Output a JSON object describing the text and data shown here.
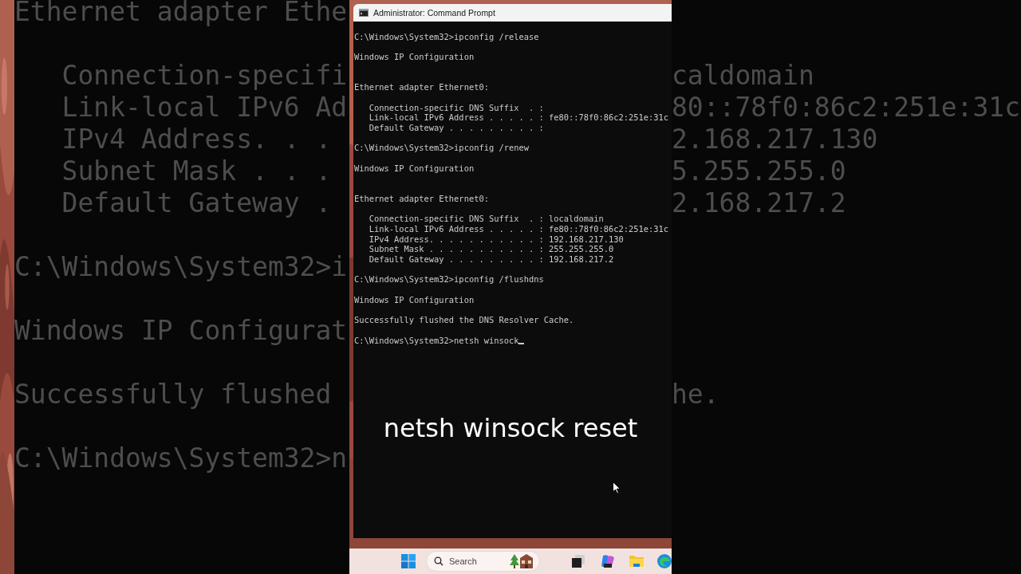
{
  "background_left": {
    "blocks": [
      {
        "lines": [
          "Ethernet adapter Ethe"
        ]
      },
      {
        "lines": [
          "   Connection-specifi",
          "   Link-local IPv6 Ad",
          "   IPv4 Address. . .",
          "   Subnet Mask . . .",
          "   Default Gateway ."
        ]
      },
      {
        "lines": [
          "C:\\Windows\\System32>i"
        ]
      },
      {
        "lines": [
          "Windows IP Configurat"
        ]
      },
      {
        "lines": [
          "Successfully flushed"
        ]
      },
      {
        "lines": [
          "C:\\Windows\\System32>n"
        ]
      }
    ]
  },
  "background_right": {
    "blocks": [
      {
        "lines": [
          "caldomain",
          "80::78f0:86c2:251e:31c",
          "2.168.217.130",
          "5.255.255.0",
          "2.168.217.2"
        ]
      },
      {
        "lines": [
          "he."
        ]
      }
    ]
  },
  "window": {
    "title": "Administrator: Command Prompt",
    "cursor": true,
    "console": [
      {
        "kind": "command",
        "lines": [
          "C:\\Windows\\System32>ipconfig /release"
        ]
      },
      {
        "kind": "output",
        "lines": [
          "Windows IP Configuration"
        ]
      },
      {
        "kind": "adapter",
        "lines": [
          "Ethernet adapter Ethernet0:"
        ]
      },
      {
        "kind": "output",
        "lines": [
          "   Connection-specific DNS Suffix  . :",
          "   Link-local IPv6 Address . . . . . : fe80::78f0:86c2:251e:31c",
          "   Default Gateway . . . . . . . . . :"
        ]
      },
      {
        "kind": "command",
        "lines": [
          "C:\\Windows\\System32>ipconfig /renew"
        ]
      },
      {
        "kind": "output",
        "lines": [
          "Windows IP Configuration"
        ]
      },
      {
        "kind": "adapter",
        "lines": [
          "Ethernet adapter Ethernet0:"
        ]
      },
      {
        "kind": "output",
        "lines": [
          "   Connection-specific DNS Suffix  . : localdomain",
          "   Link-local IPv6 Address . . . . . : fe80::78f0:86c2:251e:31c",
          "   IPv4 Address. . . . . . . . . . . : 192.168.217.130",
          "   Subnet Mask . . . . . . . . . . . : 255.255.255.0",
          "   Default Gateway . . . . . . . . . : 192.168.217.2"
        ]
      },
      {
        "kind": "command",
        "lines": [
          "C:\\Windows\\System32>ipconfig /flushdns"
        ]
      },
      {
        "kind": "output",
        "lines": [
          "Windows IP Configuration"
        ]
      },
      {
        "kind": "output",
        "lines": [
          "Successfully flushed the DNS Resolver Cache."
        ]
      },
      {
        "kind": "command",
        "lines": [
          "C:\\Windows\\System32>netsh winsock"
        ]
      }
    ]
  },
  "caption": "netsh winsock reset",
  "taskbar": {
    "search": {
      "placeholder": "Search"
    }
  }
}
